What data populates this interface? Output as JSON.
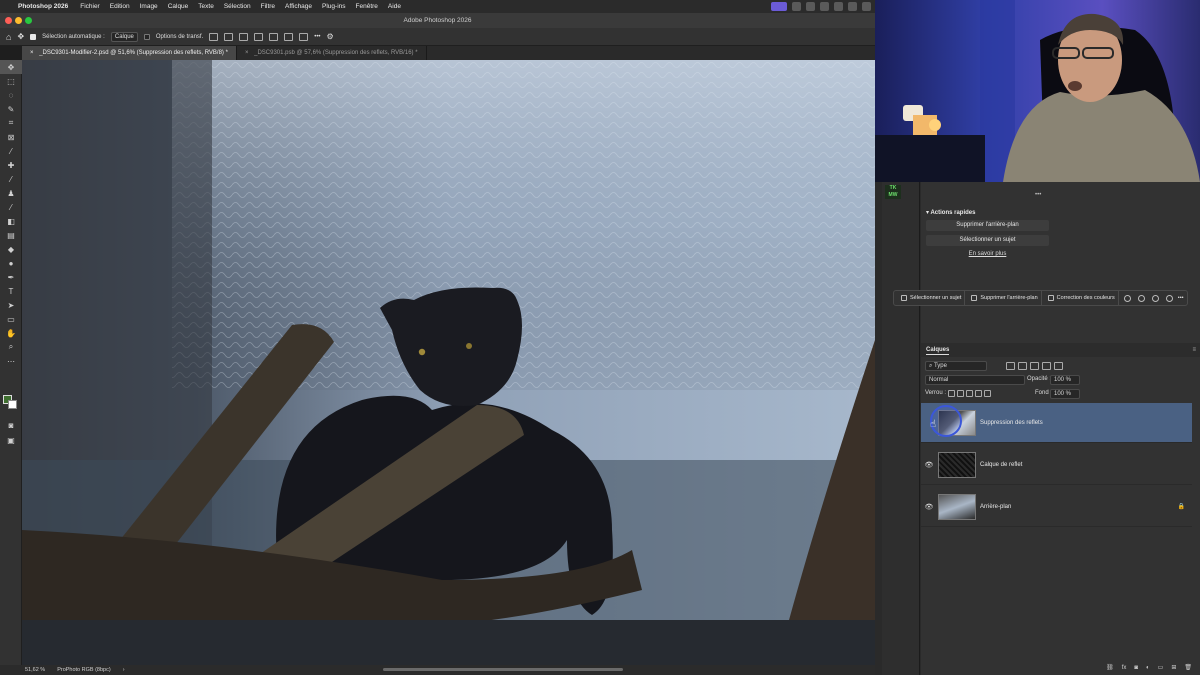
{
  "menubar": {
    "apple": "",
    "app": "Photoshop 2026",
    "items": [
      "Fichier",
      "Edition",
      "Image",
      "Calque",
      "Texte",
      "Sélection",
      "Filtre",
      "Affichage",
      "Plug-ins",
      "Fenêtre",
      "Aide"
    ]
  },
  "window": {
    "title": "Adobe Photoshop 2026"
  },
  "options": {
    "auto_select_label": "Sélection automatique :",
    "auto_select_value": "Calque",
    "transform_label": "Options de transf.",
    "more": "•••"
  },
  "tabs": [
    {
      "label": "_DSC9301-Modifier-2.psd @ 51,6% (Suppression des reflets, RVB/8) *",
      "close": "×"
    },
    {
      "label": "_DSC9301.psb @ 57,6% (Suppression des reflets, RVB/16) *",
      "close": "×"
    }
  ],
  "status": {
    "zoom": "51,62 %",
    "profile": "ProPhoto RGB (8bpc)",
    "arrow": "›"
  },
  "quick_actions": {
    "title": "Actions rapides",
    "remove_bg": "Supprimer l'arrière-plan",
    "select_subject": "Sélectionner un sujet",
    "learn_more": "En savoir plus"
  },
  "contextual_bar": {
    "select_subject": "Sélectionner un sujet",
    "remove_bg": "Supprimer l'arrière-plan",
    "color_correction": "Correction des couleurs",
    "more": "•••"
  },
  "layers_panel": {
    "title": "Calques",
    "filter": "Type",
    "blend_mode": "Normal",
    "opacity_label": "Opacité :",
    "opacity_value": "100 %",
    "lock_label": "Verrou :",
    "fill_label": "Fond :",
    "fill_value": "100 %",
    "layers": [
      {
        "name": "Suppression des reflets",
        "selected": true,
        "visible": true,
        "locked": false
      },
      {
        "name": "Calque de reflet",
        "selected": false,
        "visible": true,
        "locked": false
      },
      {
        "name": "Arrière-plan",
        "selected": false,
        "visible": true,
        "locked": true
      }
    ]
  },
  "icons": {
    "eye": "👁",
    "lock": "🔒",
    "home": "⌂",
    "gear": "⚙"
  },
  "colors": {
    "accent": "#4a6183",
    "foreground_swatch": "#3f6f30",
    "tk_badge": "#6de06d"
  },
  "badge": {
    "line1": "TK",
    "line2": "MW"
  }
}
